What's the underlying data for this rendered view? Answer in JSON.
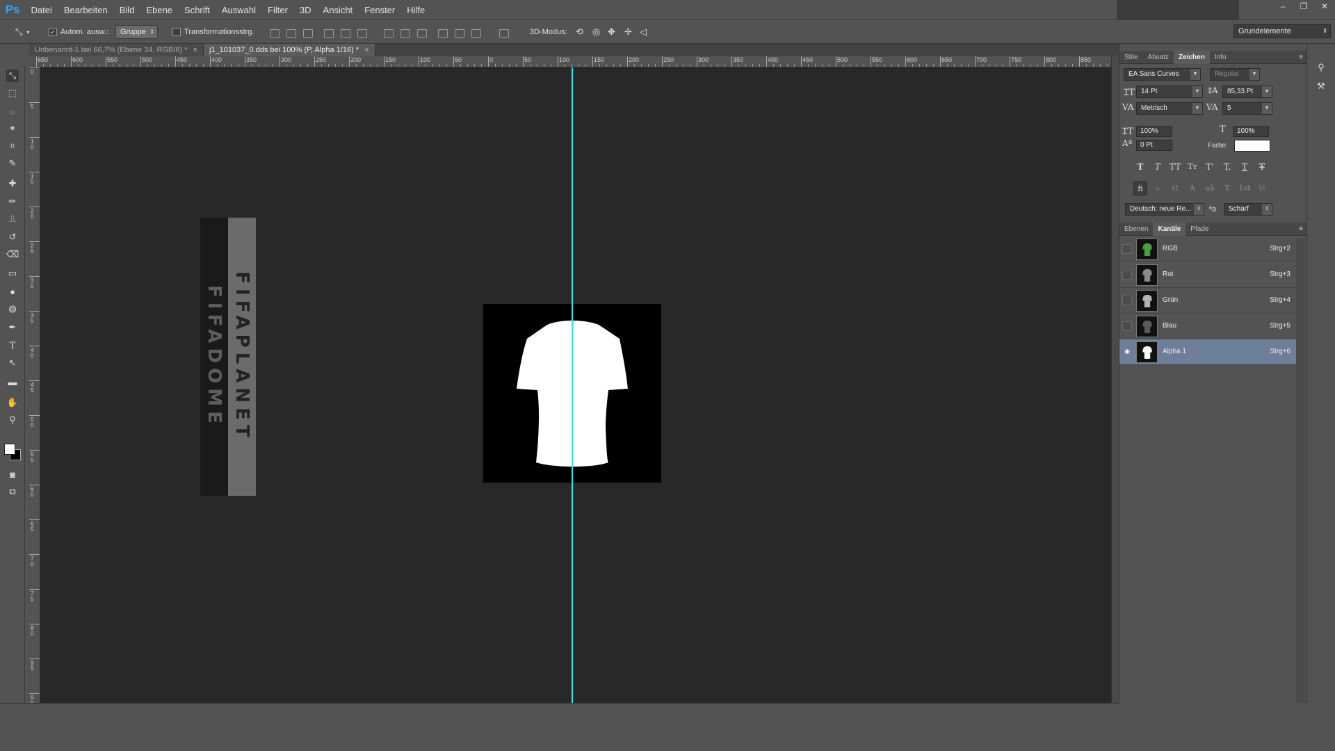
{
  "app": {
    "logo": "Ps"
  },
  "menu": [
    "Datei",
    "Bearbeiten",
    "Bild",
    "Ebene",
    "Schrift",
    "Auswahl",
    "Filter",
    "3D",
    "Ansicht",
    "Fenster",
    "Hilfe"
  ],
  "window_controls": {
    "minimize": "–",
    "restore": "❐",
    "close": "✕"
  },
  "options": {
    "auto_select_label": "Autom. ausw.:",
    "auto_select_checked": true,
    "auto_select_value": "Gruppe",
    "transform_label": "Transformationsstrg.",
    "transform_checked": false,
    "mode3d_label": "3D-Modus:",
    "workspace": "Grundelemente"
  },
  "tabs": [
    {
      "label": "Unbenannt-1 bei 66,7% (Ebene 34, RGB/8) *",
      "close": "×",
      "active": false
    },
    {
      "label": "j1_101037_0.dds bei 100% (P, Alpha 1/16) *",
      "close": "×",
      "active": true
    }
  ],
  "ruler": {
    "h_labels": [
      "650",
      "600",
      "550",
      "500",
      "450",
      "400",
      "350",
      "300",
      "250",
      "200",
      "150",
      "100",
      "50",
      "0",
      "50",
      "100",
      "150",
      "200",
      "250",
      "300",
      "350",
      "400",
      "450",
      "500",
      "550",
      "600",
      "650",
      "700",
      "750",
      "800",
      "850"
    ],
    "v_labels": [
      "0",
      "5",
      "1 0",
      "1 5",
      "2 0",
      "2 5",
      "3 0",
      "3 5",
      "4 0",
      "4 5",
      "5 0",
      "5 5",
      "6 0",
      "6 5",
      "7 0",
      "7 5",
      "8 0",
      "8 5",
      "9 0",
      "9 5"
    ]
  },
  "canvas": {
    "banner_text_dark": "FIFADOME",
    "banner_text_light": "FIFAPLANET",
    "guide_color": "#2de8f0",
    "shirt_color": "#ffffff"
  },
  "character_panel": {
    "tabs": [
      "Stile",
      "Absatz",
      "Zeichen",
      "Info"
    ],
    "active_tab": "Zeichen",
    "menu_icon": "≡",
    "font_family": "EA Sans Curves",
    "font_style": "Regular",
    "font_size": "14 Pt",
    "leading": "85,33 Pt",
    "kerning": "Metrisch",
    "tracking": "5",
    "vertical_scale": "100%",
    "horizontal_scale": "100%",
    "baseline_shift": "0 Pt",
    "color_label": "Farbe:",
    "color_value": "#ffffff",
    "style_buttons": [
      "T",
      "T",
      "TT",
      "Tт",
      "T'",
      "T,",
      "T",
      "Ŧ"
    ],
    "opentype_buttons": [
      "fi",
      "ℴ",
      "st",
      "A",
      "aā",
      "T",
      "1st",
      "½"
    ],
    "language": "Deutsch: neue Re...",
    "aa_icon": "ªa",
    "antialias": "Scharf"
  },
  "channels_panel": {
    "tabs": [
      "Ebenen",
      "Kanäle",
      "Pfade"
    ],
    "active_tab": "Kanäle",
    "menu_icon": "≡",
    "channels": [
      {
        "name": "RGB",
        "shortcut": "Strg+2",
        "thumb_color": "#4aa040",
        "visible": false,
        "selected": false
      },
      {
        "name": "Rot",
        "shortcut": "Strg+3",
        "thumb_color": "#8a8a8a",
        "visible": false,
        "selected": false
      },
      {
        "name": "Grün",
        "shortcut": "Strg+4",
        "thumb_color": "#b4b4b4",
        "visible": false,
        "selected": false
      },
      {
        "name": "Blau",
        "shortcut": "Strg+5",
        "thumb_color": "#5a5a5a",
        "visible": false,
        "selected": false
      },
      {
        "name": "Alpha 1",
        "shortcut": "Strg+6",
        "thumb_color": "#ffffff",
        "visible": true,
        "selected": true
      }
    ]
  },
  "tools": [
    "move-tool",
    "marquee-tool",
    "lasso-tool",
    "magic-wand-tool",
    "crop-tool",
    "eyedropper-tool",
    "healing-brush-tool",
    "brush-tool",
    "clone-stamp-tool",
    "history-brush-tool",
    "eraser-tool",
    "gradient-tool",
    "blur-tool",
    "dodge-tool",
    "pen-tool",
    "type-tool",
    "path-selection-tool",
    "rectangle-tool",
    "hand-tool",
    "zoom-tool"
  ]
}
